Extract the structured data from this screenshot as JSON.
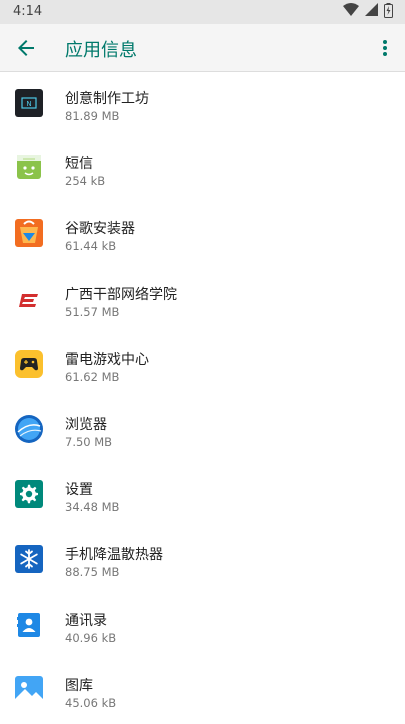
{
  "status_bar": {
    "time": "4:14"
  },
  "app_bar": {
    "title": "应用信息"
  },
  "apps": [
    {
      "name": "创意制作工坊",
      "size": "81.89 MB"
    },
    {
      "name": "短信",
      "size": "254 kB"
    },
    {
      "name": "谷歌安装器",
      "size": "61.44 kB"
    },
    {
      "name": "广西干部网络学院",
      "size": "51.57 MB"
    },
    {
      "name": "雷电游戏中心",
      "size": "61.62 MB"
    },
    {
      "name": "浏览器",
      "size": "7.50 MB"
    },
    {
      "name": "设置",
      "size": "34.48 MB"
    },
    {
      "name": "手机降温散热器",
      "size": "88.75 MB"
    },
    {
      "name": "通讯录",
      "size": "40.96 kB"
    },
    {
      "name": "图库",
      "size": "45.06 kB"
    }
  ],
  "colors": {
    "accent": "#00796b",
    "status_bar_bg": "#e6e6e6",
    "app_bar_bg": "#f5f5f5"
  }
}
